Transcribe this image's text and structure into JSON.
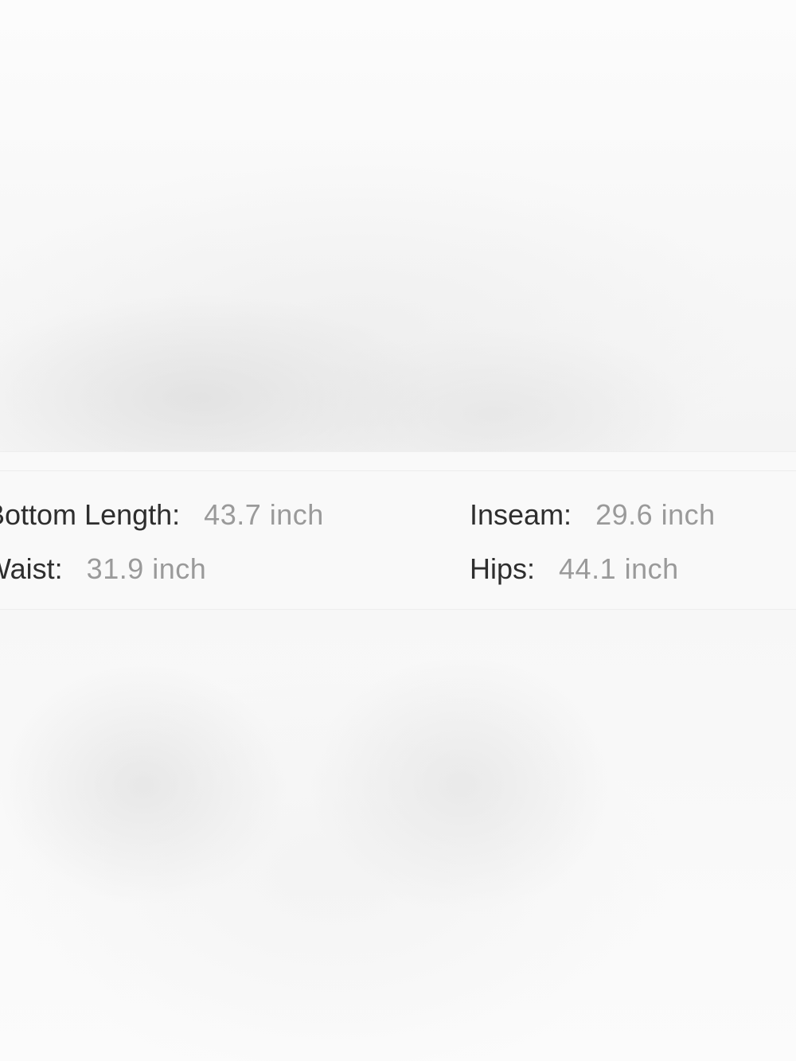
{
  "measurements": [
    {
      "label": "Bottom Length:",
      "value": "43.7 inch"
    },
    {
      "label": "Inseam:",
      "value": "29.6 inch"
    },
    {
      "label": "Waist:",
      "value": "31.9 inch"
    },
    {
      "label": "Hips:",
      "value": "44.1 inch"
    }
  ],
  "colors": {
    "label": "#2e2e2e",
    "value": "#9a9a9a",
    "panel_background": "#f9f9f9"
  }
}
